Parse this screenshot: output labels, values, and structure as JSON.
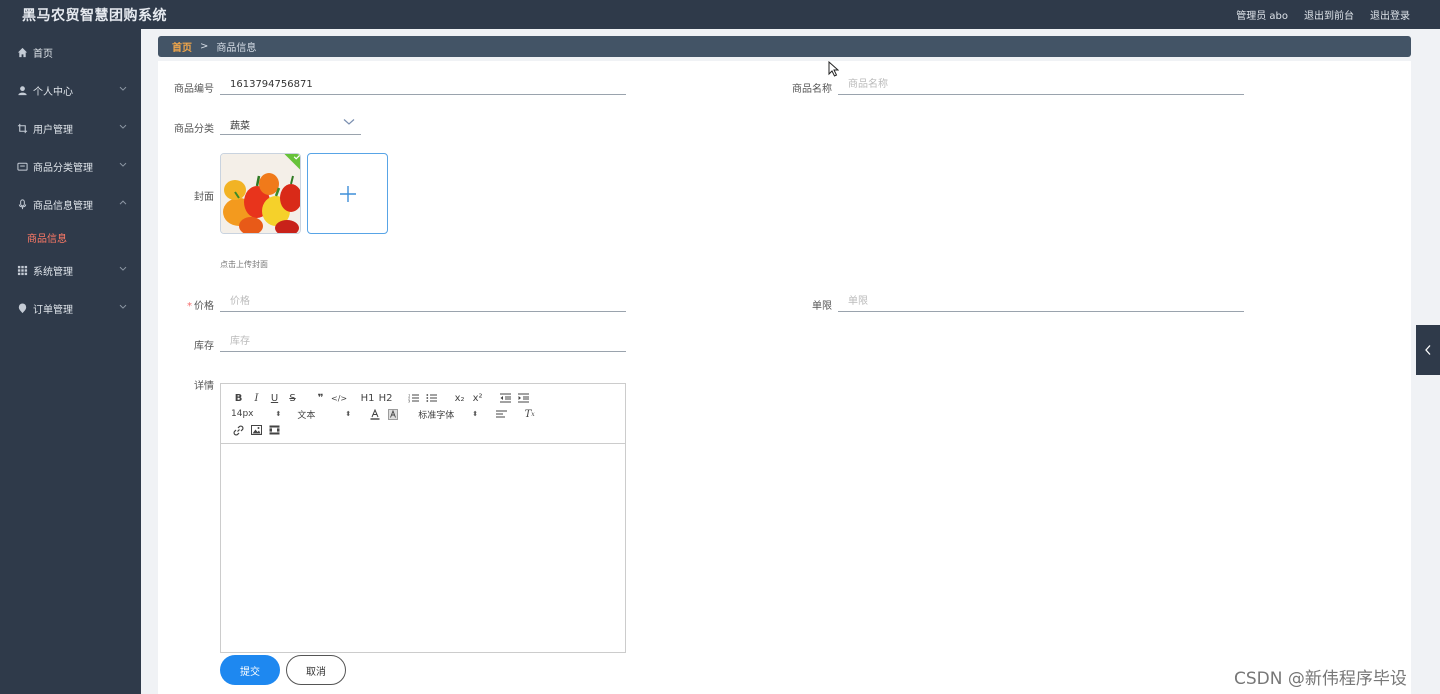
{
  "app": {
    "title": "黑马农贸智慧团购系统"
  },
  "header": {
    "user": "管理员 abo",
    "front": "退出到前台",
    "logout": "退出登录"
  },
  "sidebar": {
    "items": [
      {
        "label": "首页",
        "icon": "home-icon"
      },
      {
        "label": "个人中心",
        "icon": "user-icon"
      },
      {
        "label": "用户管理",
        "icon": "crop-icon"
      },
      {
        "label": "商品分类管理",
        "icon": "inbox-icon"
      },
      {
        "label": "商品信息管理",
        "icon": "mic-icon"
      },
      {
        "label": "系统管理",
        "icon": "grid-icon"
      },
      {
        "label": "订单管理",
        "icon": "location-icon"
      }
    ],
    "active_sub": "商品信息"
  },
  "breadcrumb": {
    "home": "首页",
    "sep": ">",
    "current": "商品信息"
  },
  "form": {
    "code_label": "商品编号",
    "code_value": "1613794756871",
    "name_label": "商品名称",
    "name_placeholder": "商品名称",
    "category_label": "商品分类",
    "category_value": "蔬菜",
    "cover_label": "封面",
    "cover_hint": "点击上传封面",
    "price_label": "价格",
    "price_placeholder": "价格",
    "limit_label": "单限",
    "limit_placeholder": "单限",
    "stock_label": "库存",
    "stock_placeholder": "库存",
    "detail_label": "详情",
    "submit": "提交",
    "cancel": "取消"
  },
  "editor": {
    "size": "14px",
    "header": "文本",
    "font": "标准字体",
    "h1": "H1",
    "h2": "H2",
    "sub": "x₂",
    "sup": "x²"
  },
  "watermark": "CSDN @新伟程序毕设",
  "colors": {
    "sidebar": "#2f3a4a",
    "breadcrumb": "#435466",
    "primary": "#1e88f0",
    "active": "#ff7a66"
  }
}
